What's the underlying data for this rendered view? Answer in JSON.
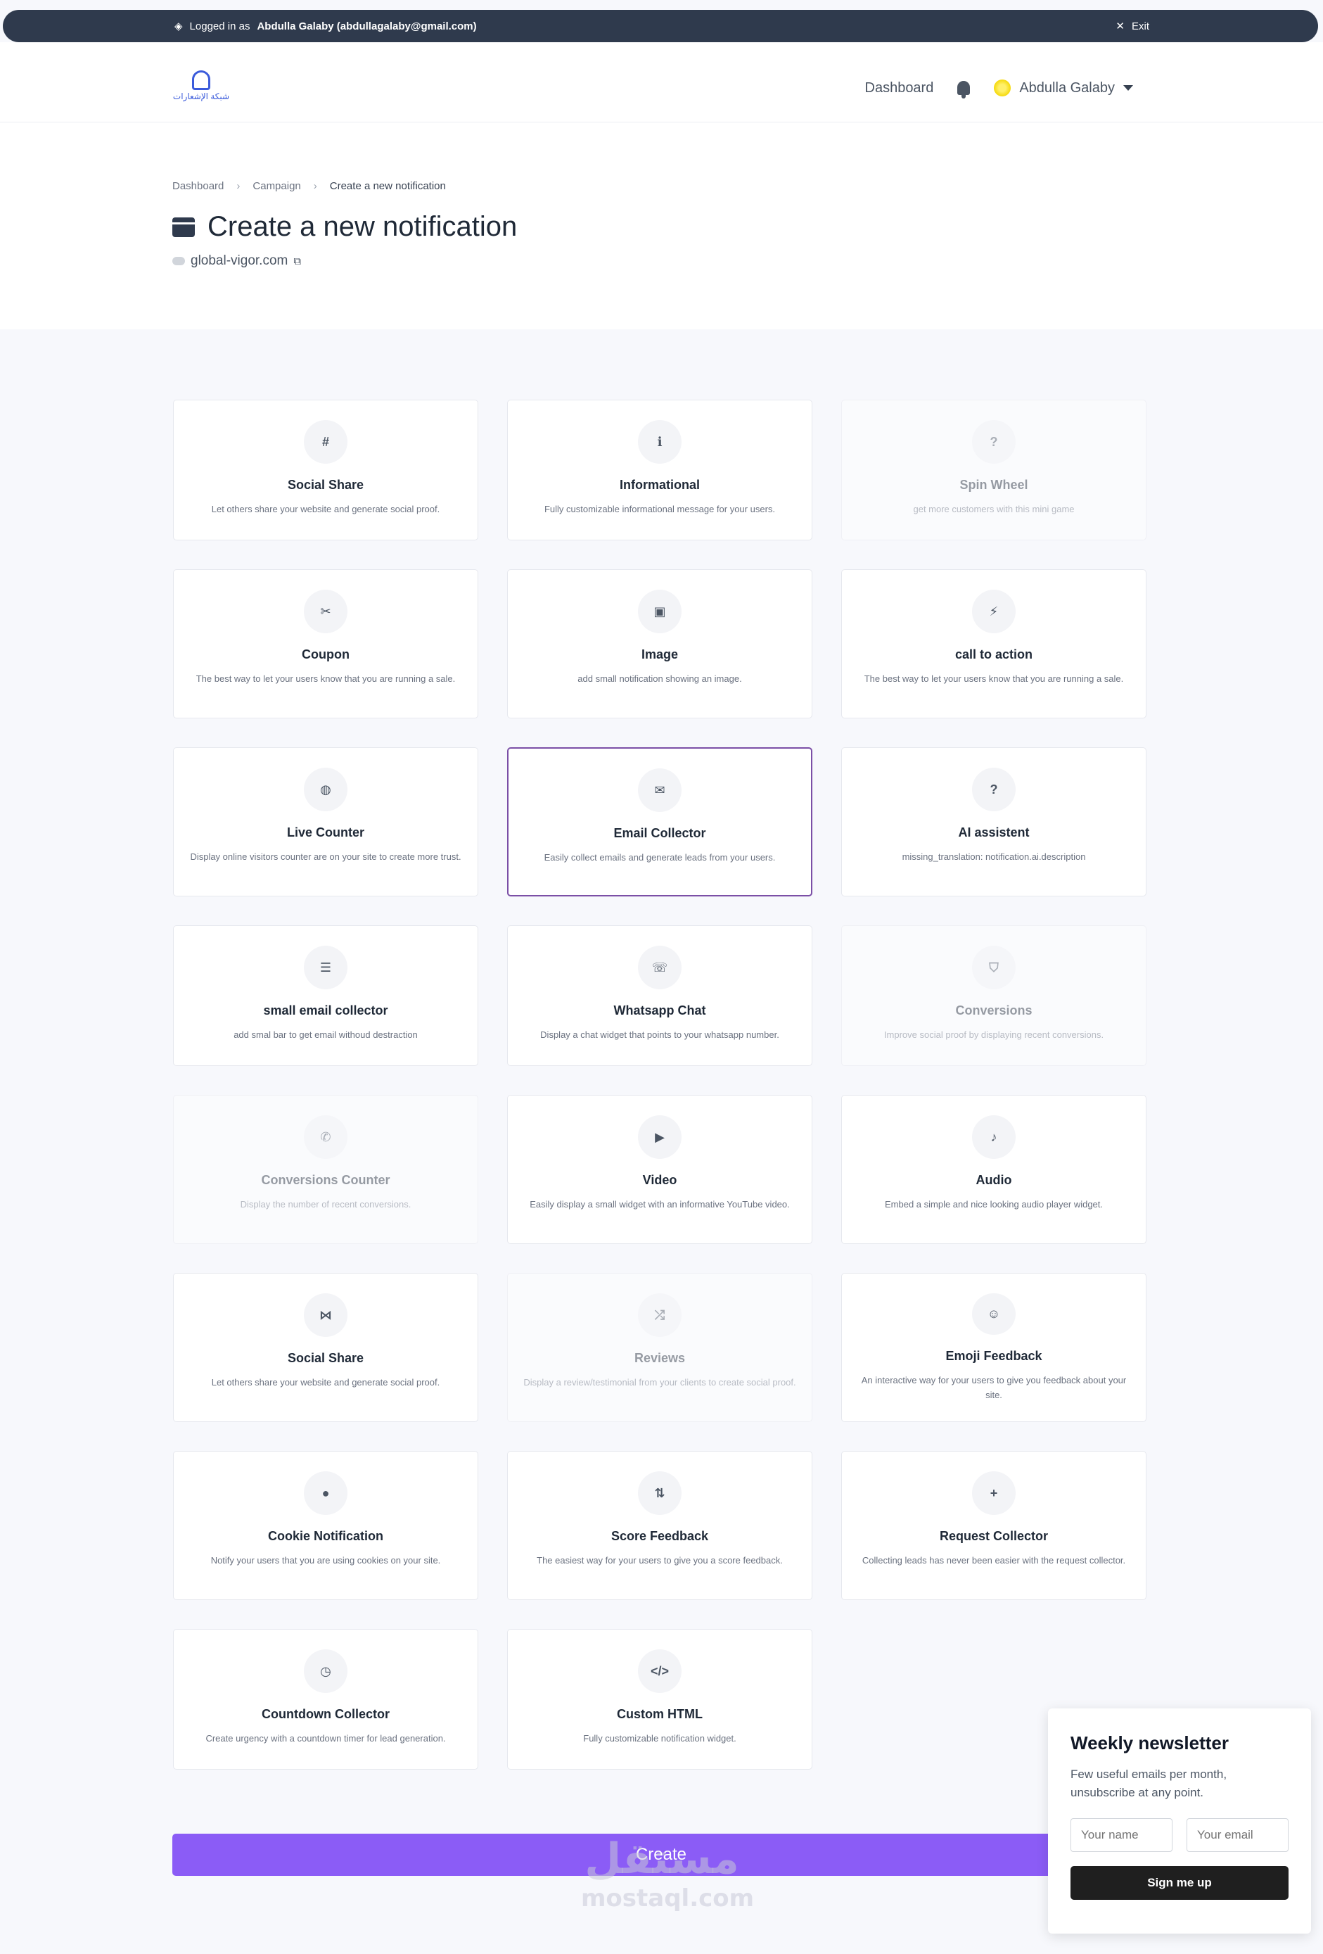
{
  "adminbar": {
    "prefix": "Logged in as",
    "user": "Abdulla Galaby (abdullagalaby@gmail.com)",
    "exit_label": "Exit"
  },
  "header": {
    "logo_text": "شبكة الإشعارات",
    "nav_dashboard": "Dashboard",
    "user_name": "Abdulla Galaby"
  },
  "breadcrumb": {
    "items": [
      "Dashboard",
      "Campaign",
      "Create a new notification"
    ]
  },
  "page": {
    "title": "Create a new notification",
    "site": "global-vigor.com"
  },
  "cards": [
    {
      "icon": "#",
      "icon_name": "hashtag-icon",
      "name": "Social Share",
      "desc": "Let others share your website and generate social proof."
    },
    {
      "icon": "ℹ",
      "icon_name": "info-icon",
      "name": "Informational",
      "desc": "Fully customizable informational message for your users."
    },
    {
      "icon": "?",
      "icon_name": "question-icon",
      "name": "Spin Wheel",
      "desc": "get more customers with this mini game",
      "disabled": true
    },
    {
      "icon": "✂",
      "icon_name": "piggy-bank-icon",
      "name": "Coupon",
      "desc": "The best way to let your users know that you are running a sale."
    },
    {
      "icon": "▣",
      "icon_name": "image-icon",
      "name": "Image",
      "desc": "add small notification showing an image."
    },
    {
      "icon": "⚡",
      "icon_name": "bolt-icon",
      "name": "call to action",
      "desc": "The best way to let your users know that you are running a sale."
    },
    {
      "icon": "◍",
      "icon_name": "globe-icon",
      "name": "Live Counter",
      "desc": "Display online visitors counter are on your site to create more trust."
    },
    {
      "icon": "✉",
      "icon_name": "envelope-open-icon",
      "name": "Email Collector",
      "desc": "Easily collect emails and generate leads from your users.",
      "selected": true
    },
    {
      "icon": "?",
      "icon_name": "question-icon",
      "name": "AI assistent",
      "desc": "missing_translation: notification.ai.description"
    },
    {
      "icon": "☰",
      "icon_name": "server-icon",
      "name": "small email collector",
      "desc": "add smal bar to get email withoud destraction"
    },
    {
      "icon": "☏",
      "icon_name": "whatsapp-icon",
      "name": "Whatsapp Chat",
      "desc": "Display a chat widget that points to your whatsapp number."
    },
    {
      "icon": "⛉",
      "icon_name": "funnel-dollar-icon",
      "name": "Conversions",
      "desc": "Improve social proof by displaying recent conversions.",
      "disabled": true
    },
    {
      "icon": "✆",
      "icon_name": "comment-dollar-icon",
      "name": "Conversions Counter",
      "desc": "Display the number of recent conversions.",
      "disabled": true
    },
    {
      "icon": "▶",
      "icon_name": "video-icon",
      "name": "Video",
      "desc": "Easily display a small widget with an informative YouTube video."
    },
    {
      "icon": "♪",
      "icon_name": "volume-icon",
      "name": "Audio",
      "desc": "Embed a simple and nice looking audio player widget."
    },
    {
      "icon": "⋈",
      "icon_name": "share-icon",
      "name": "Social Share",
      "desc": "Let others share your website and generate social proof."
    },
    {
      "icon": "⤮",
      "icon_name": "random-icon",
      "name": "Reviews",
      "desc": "Display a review/testimonial from your clients to create social proof.",
      "disabled": true
    },
    {
      "icon": "☺",
      "icon_name": "smile-icon",
      "name": "Emoji Feedback",
      "desc": "An interactive way for your users to give you feedback about your site."
    },
    {
      "icon": "●",
      "icon_name": "cookie-icon",
      "name": "Cookie Notification",
      "desc": "Notify your users that you are using cookies on your site."
    },
    {
      "icon": "⇅",
      "icon_name": "sort-numeric-icon",
      "name": "Score Feedback",
      "desc": "The easiest way for your users to give you a score feedback."
    },
    {
      "icon": "+",
      "icon_name": "user-plus-icon",
      "name": "Request Collector",
      "desc": "Collecting leads has never been easier with the request collector."
    },
    {
      "icon": "◷",
      "icon_name": "clock-icon",
      "name": "Countdown Collector",
      "desc": "Create urgency with a countdown timer for lead generation."
    },
    {
      "icon": "</>",
      "icon_name": "code-icon",
      "name": "Custom HTML",
      "desc": "Fully customizable notification widget."
    }
  ],
  "create_label": "Create",
  "watermark": {
    "arabic": "مستقل",
    "latin": "mostaql.com"
  },
  "newsletter": {
    "title": "Weekly newsletter",
    "text": "Few useful emails per month, unsubscribe at any point.",
    "name_placeholder": "Your name",
    "email_placeholder": "Your email",
    "button": "Sign me up"
  },
  "colors": {
    "accent": "#8b5cf6",
    "selected_border": "#7b4fa6",
    "adminbar": "#2f3a4d"
  }
}
